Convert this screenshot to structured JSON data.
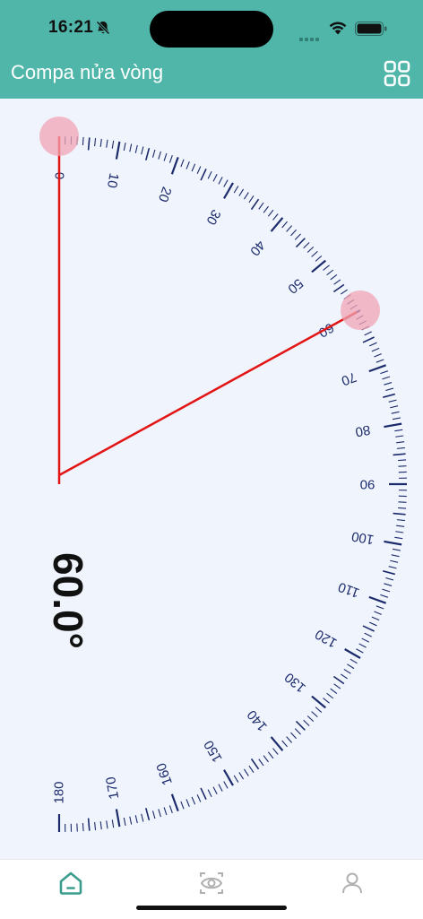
{
  "status_bar": {
    "time": "16:21",
    "icons": [
      "bell-slash-icon",
      "signal-icon",
      "wifi-icon",
      "battery-icon"
    ]
  },
  "header": {
    "title": "Compa nửa vòng",
    "menu_icon": "grid-icon"
  },
  "protractor": {
    "angle": 60,
    "angle_label": "60.0°",
    "scale_min": 0,
    "scale_max": 180,
    "tick_labels": [
      "0",
      "10",
      "20",
      "30",
      "40",
      "50",
      "60",
      "70",
      "80",
      "90",
      "100",
      "110",
      "120",
      "130",
      "140",
      "150",
      "160",
      "170",
      "180"
    ],
    "colors": {
      "tick": "#1b2a6b",
      "arm": "#e21414",
      "handle": "#f2a6b4",
      "background": "#f0f4fd"
    }
  },
  "tab_bar": {
    "tabs": [
      {
        "name": "home",
        "icon": "home-icon",
        "active": true
      },
      {
        "name": "camera-protractor",
        "icon": "eye-scan-icon",
        "active": false
      },
      {
        "name": "profile",
        "icon": "user-icon",
        "active": false
      }
    ],
    "active_color": "#3a9d8c",
    "inactive_color": "#b0b0b0"
  }
}
